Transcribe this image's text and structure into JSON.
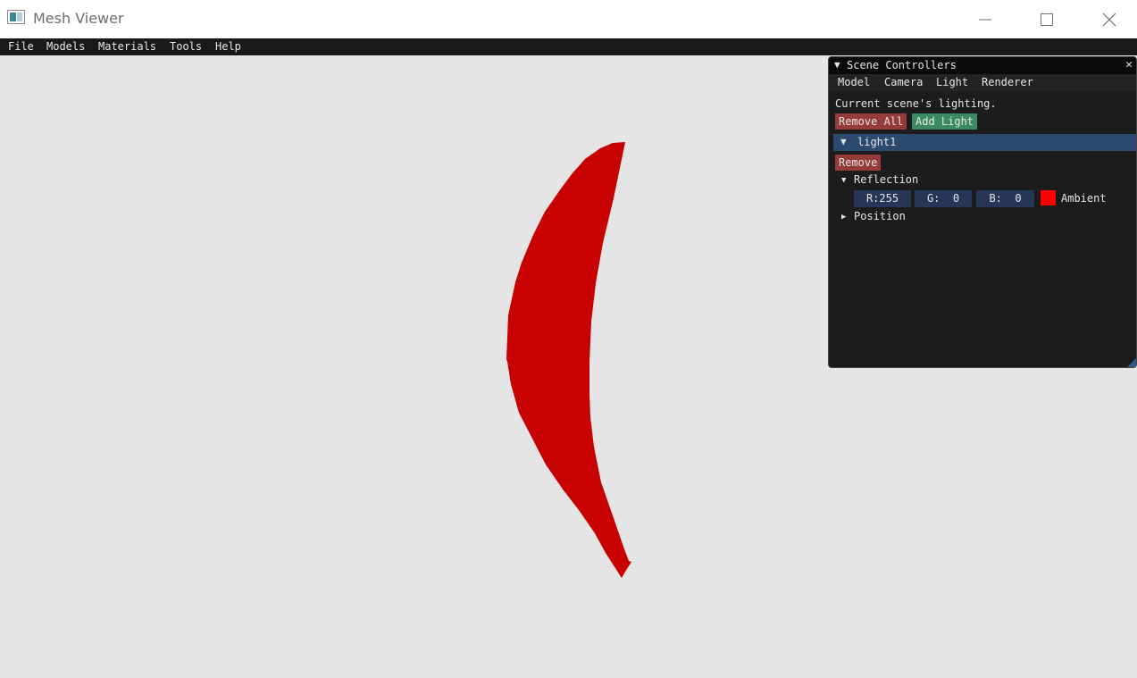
{
  "window": {
    "title": "Mesh Viewer"
  },
  "menu": {
    "items": [
      "File",
      "Models",
      "Materials",
      "Tools",
      "Help"
    ]
  },
  "viewport": {
    "mesh_color": "#c80000",
    "background_color": "#e5e5e5"
  },
  "panel": {
    "title": "Scene Controllers",
    "tabs": [
      "Model",
      "Camera",
      "Light",
      "Renderer"
    ],
    "description": "Current scene's lighting.",
    "remove_all_label": "Remove All",
    "add_light_label": "Add Light",
    "light": {
      "name": "light1",
      "remove_label": "Remove",
      "reflection_label": "Reflection",
      "r_field": "R:255",
      "g_field": "G:  0",
      "b_field": "B:  0",
      "color": "#ff0000",
      "color_label": "Ambient",
      "position_label": "Position"
    }
  }
}
